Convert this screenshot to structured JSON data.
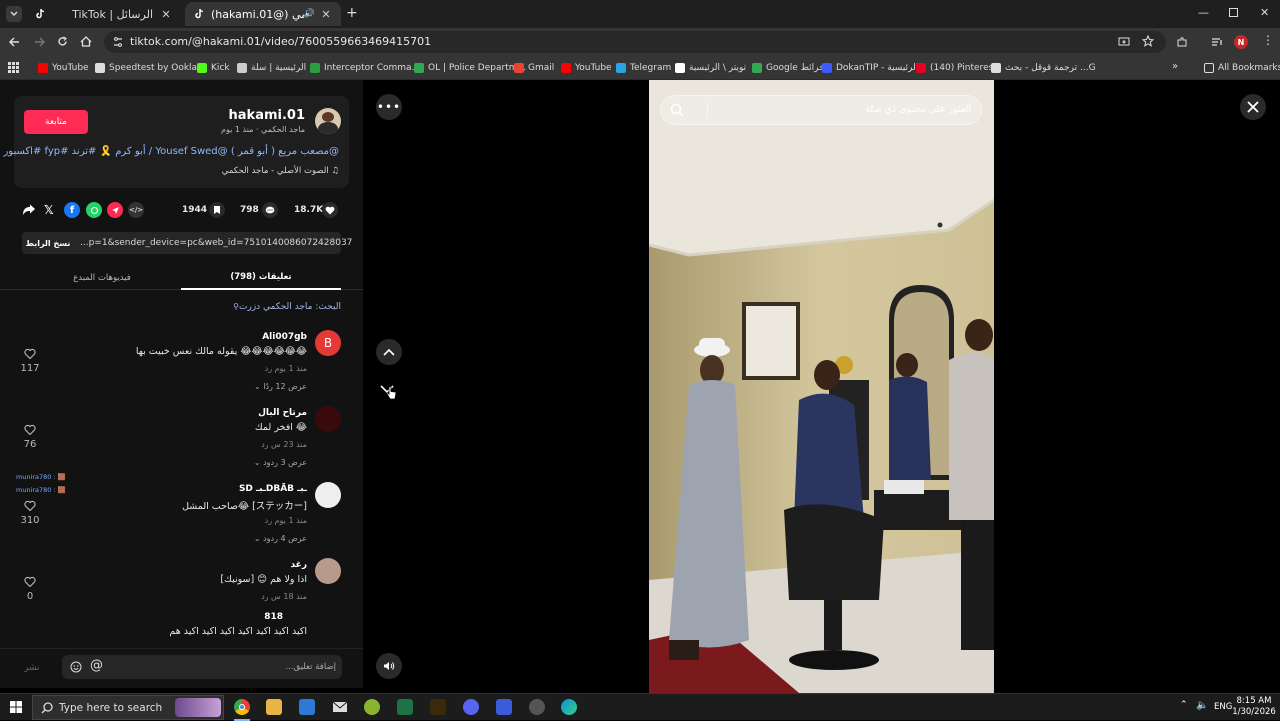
{
  "browser": {
    "tabs": [
      {
        "title": "TikTok | الرسائل",
        "active": false
      },
      {
        "title": "(hakami.01@) ماجد الحكمي",
        "active": true
      }
    ],
    "new_tab": "+",
    "url": "tiktok.com/@hakami.01/video/7600559663469415701",
    "bookmarks": [
      {
        "label": "YouTube",
        "color": "#ff0000"
      },
      {
        "label": "Speedtest by Ookla...",
        "color": "#dddddd"
      },
      {
        "label": "Kick",
        "color": "#53fc18"
      },
      {
        "label": "الرئيسية | سلة",
        "color": "#cccccc"
      },
      {
        "label": "Interceptor Comma...",
        "color": "#2e9e44"
      },
      {
        "label": "OL | Police Departm...",
        "color": "#34a853"
      },
      {
        "label": "Gmail",
        "color": "#ea4335"
      },
      {
        "label": "YouTube",
        "color": "#ff0000"
      },
      {
        "label": "Telegram",
        "color": "#2aa3e0"
      },
      {
        "label": "تويتر \\ الرئيسية",
        "color": "#ffffff"
      },
      {
        "label": "Google خرائط",
        "color": "#34a853"
      },
      {
        "label": "DokanTIP - الرئيسية",
        "color": "#3d5afe"
      },
      {
        "label": "(140) Pinterest",
        "color": "#e60023"
      },
      {
        "label": "ترجمة قوقل - بحث ...G",
        "color": "#dddddd"
      }
    ],
    "all_bookmarks": "All Bookmarks",
    "profile_letter": "N"
  },
  "post": {
    "follow_label": "متابعة",
    "username": "hakami.01",
    "subline": "ماجد الحكمي · منذ 1 يوم",
    "caption_tags": "#ترند #fyp #اكسبور",
    "caption_rest": "@مصعب مريع ( أبو قمر ) @Yousef Swed / أبو كرم 🎗️",
    "sound": "♫ الصوت الأصلي - ماجد الحكمي",
    "likes": "18.7K",
    "comments_count": "798",
    "saves": "1944",
    "copy_link_label": "نسخ الرابط",
    "link_text": "...p=1&sender_device=pc&web_id=7510140086072428037"
  },
  "panel_tabs": {
    "comments": "تعليقات (798)",
    "creator_videos": "فيديوهات المبدع"
  },
  "search_hint": "البحث: ماجد الحكمي دزرت",
  "comments": [
    {
      "name": "Ali007gb",
      "text": "يقوله مالك نعس خبيت بها 😂😂😂😂😂😂",
      "meta": "منذ 1 يوم    رد",
      "more": "عرض 12 ردًا ⌄",
      "likes": "117",
      "avatar_letter": "B",
      "avatar_color": "#e53935"
    },
    {
      "name": "مرتاح البال",
      "text": "افخر لمك 😂",
      "meta": "منذ 23 س    رد",
      "more": "عرض 3 ردود ⌄",
      "likes": "76",
      "avatar_letter": "",
      "avatar_color": "#3a0a0a"
    },
    {
      "name": "SD ـبـDBĀB ـبـ",
      "text": "صاحب المشل😂 [ステッカー]",
      "meta": "منذ 1 يوم    رد",
      "more": "عرض 4 ردود ⌄",
      "likes": "310",
      "avatar_letter": "",
      "avatar_color": "#eeeeee"
    },
    {
      "name": "رغد",
      "text": "اذا ولا هم 😊 [سونيك]",
      "meta": "منذ 18 س    رد",
      "more": "",
      "likes": "0",
      "avatar_letter": "",
      "avatar_color": "#b89a8a"
    },
    {
      "name": "818",
      "text": "اكيد اكيد اكيد اكيد اكيد اكيد اكيد هم",
      "meta": "",
      "more": "",
      "likes": "",
      "avatar_letter": "",
      "avatar_color": "#111111"
    }
  ],
  "mini_users": [
    "munira780 : 🟫",
    "munira780 : 🟫"
  ],
  "composer": {
    "placeholder": "إضافة تعليق...",
    "post_label": "نشر"
  },
  "video": {
    "search_placeholder": "العثور على محتوى ذي صلة"
  },
  "taskbar": {
    "search_placeholder": "Type here to search",
    "lang": "ENG",
    "time": "8:15 AM",
    "date": "1/30/2026"
  }
}
